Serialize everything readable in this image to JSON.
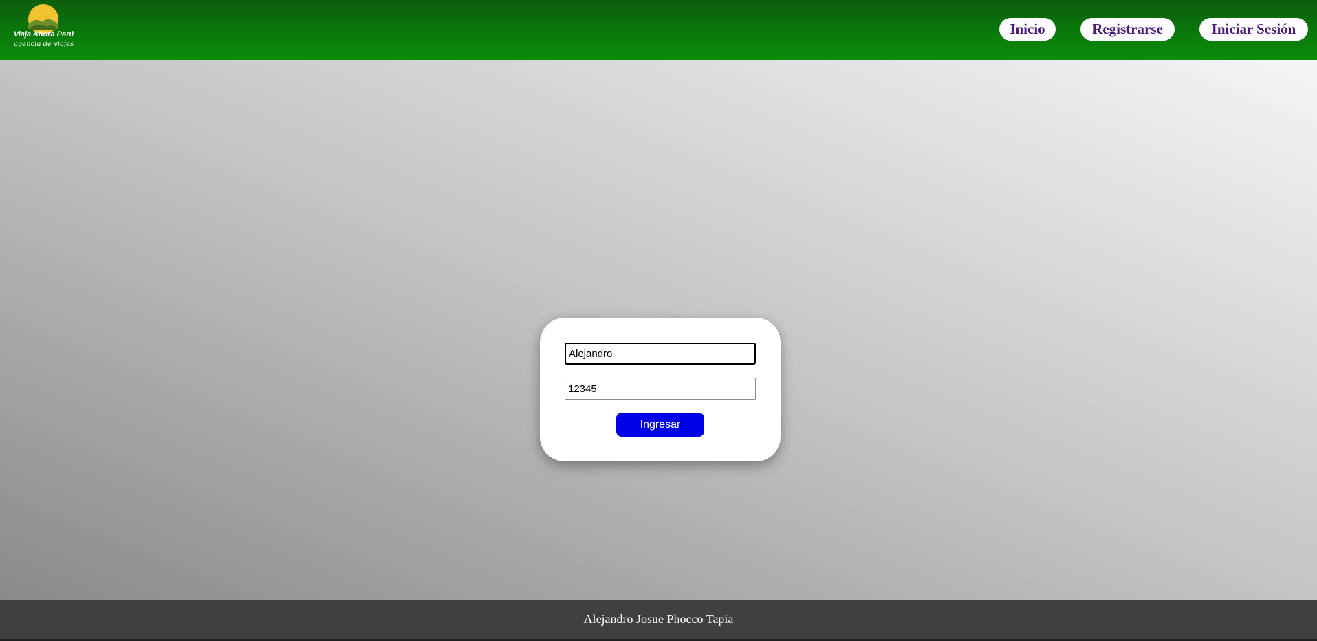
{
  "header": {
    "logo": {
      "title": "Viaja Ahora Perú",
      "tagline": "agencia de viajes"
    },
    "nav": [
      {
        "label": "Inicio"
      },
      {
        "label": "Registrarse"
      },
      {
        "label": "Iniciar Sesión"
      }
    ]
  },
  "login": {
    "username_value": "Alejandro",
    "password_value": "12345",
    "submit_label": "Ingresar"
  },
  "footer": {
    "text": "Alejandro Josue Phocco Tapia"
  },
  "colors": {
    "header_top": "#0b5e0b",
    "header_bottom": "#0a8e0a",
    "nav_text": "#4b1a7a",
    "submit_bg": "#0000e6",
    "footer_bg": "#404040"
  }
}
